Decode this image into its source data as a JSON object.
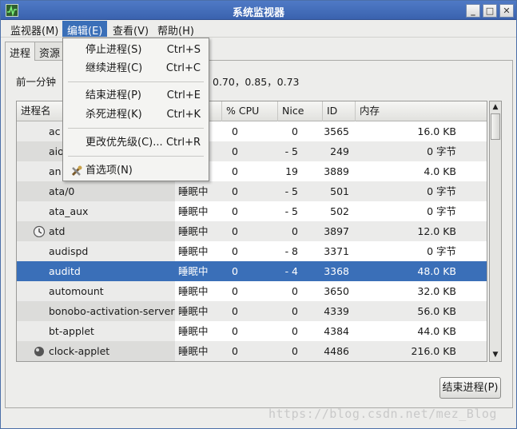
{
  "window": {
    "title": "系统监视器"
  },
  "menubar": [
    {
      "label": "监视器(M)"
    },
    {
      "label": "编辑(E)"
    },
    {
      "label": "查看(V)"
    },
    {
      "label": "帮助(H)"
    }
  ],
  "tabs": [
    {
      "label": "进程"
    },
    {
      "label": "资源"
    }
  ],
  "load": {
    "label": "前一分钟",
    "values": "0.70，0.85，0.73"
  },
  "edit_menu": {
    "items": [
      {
        "label": "停止进程(S)",
        "accel": "Ctrl+S"
      },
      {
        "label": "继续进程(C)",
        "accel": "Ctrl+C"
      },
      {
        "label": "结束进程(P)",
        "accel": "Ctrl+E"
      },
      {
        "label": "杀死进程(K)",
        "accel": "Ctrl+K"
      },
      {
        "label": "更改优先级(C)...",
        "accel": "Ctrl+R"
      },
      {
        "label": "首选项(N)",
        "accel": ""
      }
    ]
  },
  "table": {
    "headers": {
      "name": "进程名",
      "cpu": "% CPU",
      "nice": "Nice",
      "id": "ID",
      "mem": "内存"
    },
    "rows": [
      {
        "name": "ac",
        "status": "",
        "cpu": "0",
        "nice": "0",
        "id": "3565",
        "mem": "16.0 KB"
      },
      {
        "name": "aio",
        "status": "",
        "cpu": "0",
        "nice": "- 5",
        "id": "249",
        "mem": "0 字节"
      },
      {
        "name": "an",
        "status": "",
        "cpu": "0",
        "nice": "19",
        "id": "3889",
        "mem": "4.0 KB"
      },
      {
        "name": "ata/0",
        "status": "睡眠中",
        "cpu": "0",
        "nice": "- 5",
        "id": "501",
        "mem": "0 字节"
      },
      {
        "name": "ata_aux",
        "status": "睡眠中",
        "cpu": "0",
        "nice": "- 5",
        "id": "502",
        "mem": "0 字节"
      },
      {
        "name": "atd",
        "status": "睡眠中",
        "cpu": "0",
        "nice": "0",
        "id": "3897",
        "mem": "12.0 KB"
      },
      {
        "name": "audispd",
        "status": "睡眠中",
        "cpu": "0",
        "nice": "- 8",
        "id": "3371",
        "mem": "0 字节"
      },
      {
        "name": "auditd",
        "status": "睡眠中",
        "cpu": "0",
        "nice": "- 4",
        "id": "3368",
        "mem": "48.0 KB"
      },
      {
        "name": "automount",
        "status": "睡眠中",
        "cpu": "0",
        "nice": "0",
        "id": "3650",
        "mem": "32.0 KB"
      },
      {
        "name": "bonobo-activation-server",
        "status": "睡眠中",
        "cpu": "0",
        "nice": "0",
        "id": "4339",
        "mem": "56.0 KB"
      },
      {
        "name": "bt-applet",
        "status": "睡眠中",
        "cpu": "0",
        "nice": "0",
        "id": "4384",
        "mem": "44.0 KB"
      },
      {
        "name": "clock-applet",
        "status": "睡眠中",
        "cpu": "0",
        "nice": "0",
        "id": "4486",
        "mem": "216.0 KB"
      }
    ],
    "selected_index": 7
  },
  "end_button": {
    "label": "结束进程(P)"
  },
  "watermark": "https://blog.csdn.net/mez_Blog",
  "colors": {
    "selection": "#3a6fb8",
    "titlebar": "#3a62ae"
  }
}
